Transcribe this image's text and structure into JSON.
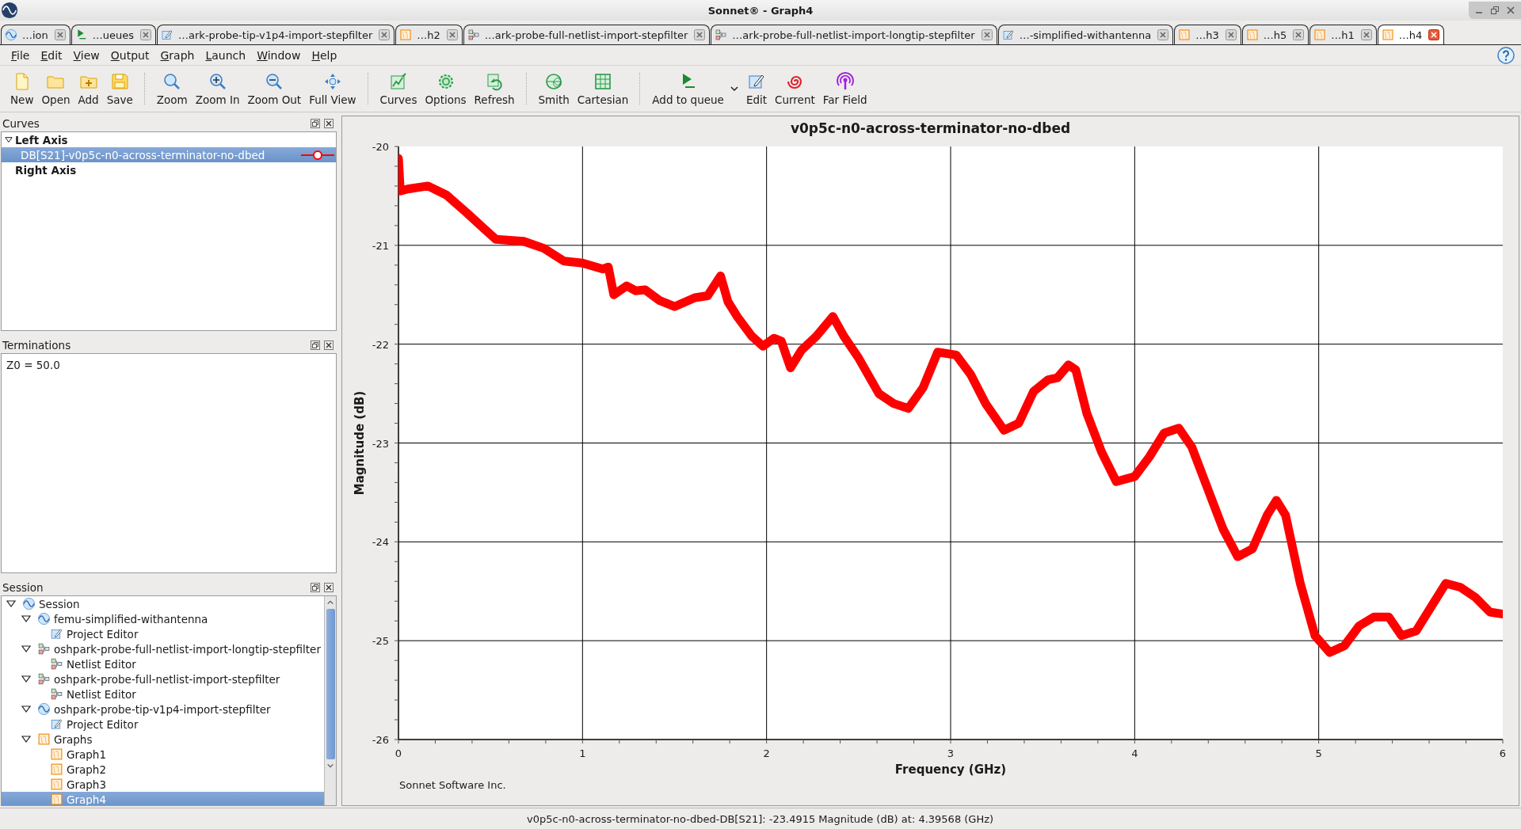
{
  "window": {
    "title": "Sonnet® - Graph4"
  },
  "tabs": [
    {
      "label": "…ion",
      "kind": "wave",
      "selected": false
    },
    {
      "label": "…ueues",
      "kind": "em",
      "selected": false
    },
    {
      "label": "…ark-probe-tip-v1p4-import-stepfilter",
      "kind": "editor",
      "selected": false
    },
    {
      "label": "…h2",
      "kind": "graph",
      "selected": false
    },
    {
      "label": "…ark-probe-full-netlist-import-stepfilter",
      "kind": "netlist",
      "selected": false
    },
    {
      "label": "…ark-probe-full-netlist-import-longtip-stepfilter",
      "kind": "netlist",
      "selected": false
    },
    {
      "label": "…-simplified-withantenna",
      "kind": "editor",
      "selected": false
    },
    {
      "label": "…h3",
      "kind": "graph",
      "selected": false
    },
    {
      "label": "…h5",
      "kind": "graph",
      "selected": false
    },
    {
      "label": "…h1",
      "kind": "graph",
      "selected": false
    },
    {
      "label": "…h4",
      "kind": "graph",
      "selected": true
    }
  ],
  "menu": [
    "File",
    "Edit",
    "View",
    "Output",
    "Graph",
    "Launch",
    "Window",
    "Help"
  ],
  "toolbar": [
    [
      {
        "label": "New",
        "kind": "new"
      },
      {
        "label": "Open",
        "kind": "open"
      },
      {
        "label": "Add",
        "kind": "add"
      },
      {
        "label": "Save",
        "kind": "save"
      }
    ],
    [
      {
        "label": "Zoom",
        "kind": "zoom"
      },
      {
        "label": "Zoom In",
        "kind": "zoomin"
      },
      {
        "label": "Zoom Out",
        "kind": "zoomout"
      },
      {
        "label": "Full View",
        "kind": "fullview"
      }
    ],
    [
      {
        "label": "Curves",
        "kind": "curves"
      },
      {
        "label": "Options",
        "kind": "options"
      },
      {
        "label": "Refresh",
        "kind": "refresh"
      }
    ],
    [
      {
        "label": "Smith",
        "kind": "smith"
      },
      {
        "label": "Cartesian",
        "kind": "cartesian"
      }
    ],
    [
      {
        "label": "Add to queue",
        "kind": "em",
        "menu": true
      },
      {
        "label": "Edit",
        "kind": "edit"
      },
      {
        "label": "Current",
        "kind": "current"
      },
      {
        "label": "Far Field",
        "kind": "farfield"
      }
    ]
  ],
  "curves": {
    "title": "Curves",
    "axes": [
      {
        "label": "Left Axis",
        "expanded": true,
        "curves": [
          {
            "label": "DB[S21]-v0p5c-n0-across-terminator-no-dbed",
            "selected": true,
            "color": "#ff0000"
          }
        ]
      },
      {
        "label": "Right Axis"
      }
    ]
  },
  "terminations": {
    "title": "Terminations",
    "text": "Z0 = 50.0"
  },
  "session": {
    "title": "Session",
    "tree": [
      {
        "label": "Session",
        "kind": "wave",
        "expanded": true,
        "selected": false,
        "children": [
          {
            "label": "femu-simplified-withantenna",
            "kind": "wave",
            "expanded": true,
            "selected": false,
            "children": [
              {
                "label": "Project Editor",
                "kind": "editor",
                "selected": false
              }
            ]
          },
          {
            "label": "oshpark-probe-full-netlist-import-longtip-stepfilter",
            "kind": "netlist",
            "expanded": true,
            "selected": false,
            "children": [
              {
                "label": "Netlist Editor",
                "kind": "netlist",
                "selected": false
              }
            ]
          },
          {
            "label": "oshpark-probe-full-netlist-import-stepfilter",
            "kind": "netlist",
            "expanded": true,
            "selected": false,
            "children": [
              {
                "label": "Netlist Editor",
                "kind": "netlist",
                "selected": false
              }
            ]
          },
          {
            "label": "oshpark-probe-tip-v1p4-import-stepfilter",
            "kind": "wave",
            "expanded": true,
            "selected": false,
            "children": [
              {
                "label": "Project Editor",
                "kind": "editor",
                "selected": false
              }
            ]
          },
          {
            "label": "Graphs",
            "kind": "graph",
            "expanded": true,
            "selected": false,
            "children": [
              {
                "label": "Graph1",
                "kind": "graph",
                "selected": false
              },
              {
                "label": "Graph2",
                "kind": "graph",
                "selected": false
              },
              {
                "label": "Graph3",
                "kind": "graph",
                "selected": false
              },
              {
                "label": "Graph4",
                "kind": "graph",
                "selected": true
              }
            ]
          }
        ]
      }
    ]
  },
  "graph": {
    "chart_data": {
      "type": "line",
      "title": "v0p5c-n0-across-terminator-no-dbed",
      "xlabel": "Frequency (GHz)",
      "ylabel": "Magnitude (dB)",
      "grid": true,
      "xlim": [
        0,
        6
      ],
      "ylim": [
        -26,
        -20
      ],
      "xticks": [
        0,
        1,
        2,
        3,
        4,
        5,
        6
      ],
      "yticks": [
        -20,
        -21,
        -22,
        -23,
        -24,
        -25,
        -26
      ],
      "x": [
        0,
        0.01,
        0.05,
        0.16,
        0.26,
        0.37,
        0.47,
        0.53,
        0.68,
        0.79,
        0.9,
        1.0,
        1.11,
        1.14,
        1.17,
        1.24,
        1.29,
        1.34,
        1.42,
        1.5,
        1.61,
        1.68,
        1.75,
        1.79,
        1.84,
        1.92,
        1.98,
        2.04,
        2.08,
        2.13,
        2.19,
        2.27,
        2.36,
        2.42,
        2.5,
        2.61,
        2.69,
        2.77,
        2.85,
        2.93,
        3.03,
        3.11,
        3.19,
        3.29,
        3.37,
        3.45,
        3.53,
        3.58,
        3.64,
        3.68,
        3.74,
        3.82,
        3.9,
        4.0,
        4.08,
        4.16,
        4.24,
        4.31,
        4.4,
        4.48,
        4.56,
        4.64,
        4.72,
        4.77,
        4.82,
        4.9,
        4.98,
        5.06,
        5.14,
        5.22,
        5.3,
        5.38,
        5.45,
        5.53,
        5.61,
        5.69,
        5.77,
        5.85,
        5.93,
        6.0
      ],
      "series": [
        {
          "color": "#ff0000",
          "values": [
            -20.12,
            -20.45,
            -20.43,
            -20.4,
            -20.49,
            -20.67,
            -20.84,
            -20.94,
            -20.96,
            -21.03,
            -21.16,
            -21.18,
            -21.24,
            -21.22,
            -21.5,
            -21.41,
            -21.46,
            -21.45,
            -21.56,
            -21.62,
            -21.53,
            -21.51,
            -21.31,
            -21.57,
            -21.72,
            -21.92,
            -22.02,
            -21.94,
            -21.97,
            -22.24,
            -22.06,
            -21.92,
            -21.72,
            -21.92,
            -22.14,
            -22.5,
            -22.6,
            -22.65,
            -22.44,
            -22.08,
            -22.11,
            -22.31,
            -22.6,
            -22.87,
            -22.8,
            -22.48,
            -22.36,
            -22.34,
            -22.21,
            -22.26,
            -22.7,
            -23.09,
            -23.39,
            -23.34,
            -23.14,
            -22.9,
            -22.85,
            -23.04,
            -23.48,
            -23.87,
            -24.15,
            -24.07,
            -23.73,
            -23.58,
            -23.73,
            -24.42,
            -24.95,
            -25.12,
            -25.05,
            -24.85,
            -24.76,
            -24.76,
            -24.95,
            -24.9,
            -24.66,
            -24.42,
            -24.46,
            -24.56,
            -24.71,
            -24.73
          ]
        }
      ]
    },
    "footer": "Sonnet Software Inc."
  },
  "status_bar": {
    "text": "v0p5c-n0-across-terminator-no-dbed-DB[S21]: -23.4915 Magnitude (dB) at: 4.39568 (GHz)"
  }
}
